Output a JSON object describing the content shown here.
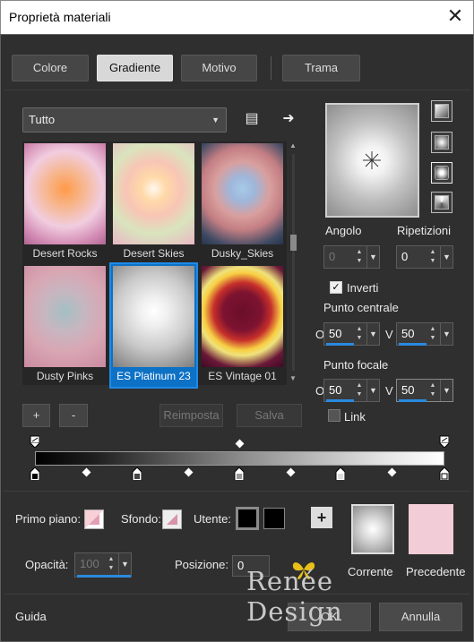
{
  "window": {
    "title": "Proprietà materiali",
    "close": "✕"
  },
  "tabs": [
    {
      "label": "Colore"
    },
    {
      "label": "Gradiente"
    },
    {
      "label": "Motivo"
    },
    {
      "label": "Trama"
    }
  ],
  "library": {
    "category": "Tutto"
  },
  "gradients": [
    {
      "name": "Desert Rocks",
      "css": "radial-gradient(circle at 50% 45%,#ff9a4a 0%,#f7b58a 25%,#f1cde0 55%,#d48eb6 80%,#b06592 100%)"
    },
    {
      "name": "Desert Skies",
      "css": "radial-gradient(circle at 50% 45%,#fff8ee 0%,#ffd9a8 18%,#f8c5b5 40%,#d9e4bd 65%,#e9b7c4 100%)"
    },
    {
      "name": "Dusky_Skies",
      "css": "radial-gradient(circle at 50% 45%,#a8c9e7 0%,#9eb7db 18%,#d99f9e 40%,#c37e83 60%,#3f4a63 85%,#27334c 100%)"
    },
    {
      "name": "Dusty Pinks",
      "css": "radial-gradient(circle at 50% 45%,#a3c0c3 0%,#c7b6c0 30%,#d9a6b3 60%,#c98aa0 100%)"
    },
    {
      "name": "ES Platinum 23",
      "css": "radial-gradient(circle at 50% 45%,#ffffff 0%,#f0f0f0 20%,#c9c9c9 55%,#7c7c7c 100%)"
    },
    {
      "name": "ES Vintage 01",
      "css": "radial-gradient(circle at 50% 45%,#6a0e2a 0%,#7d1330 28%,#c62f2b 42%,#f8cf43 56%,#efe27d 64%,#6a1837 82%,#3e0a25 100%)"
    }
  ],
  "buttons": {
    "add": "+",
    "remove": "-",
    "reset": "Reimposta",
    "save": "Salva"
  },
  "angle": {
    "label": "Angolo",
    "value": "0"
  },
  "repeats": {
    "label": "Ripetizioni",
    "value": "0"
  },
  "invert": {
    "label": "Inverti",
    "checked": true
  },
  "center": {
    "label": "Punto centrale",
    "o_label": "O",
    "v_label": "V",
    "o": "50",
    "v": "50"
  },
  "focal": {
    "label": "Punto focale",
    "o_label": "O",
    "v_label": "V",
    "o": "50",
    "v": "50"
  },
  "link": {
    "label": "Link",
    "checked": false
  },
  "bottom": {
    "foreground": "Primo piano:",
    "background": "Sfondo:",
    "user": "Utente:",
    "opacity_label": "Opacità:",
    "opacity": "100",
    "position_label": "Posizione:",
    "position": "0",
    "current": "Corrente",
    "previous": "Precedente"
  },
  "footer": {
    "help": "Guida",
    "ok": "OK",
    "cancel": "Annulla"
  },
  "watermark": "Renée Design",
  "colors": {
    "accent": "#0d71c5",
    "previous": "#f2ccd6",
    "bg": "#2f2f2f"
  }
}
